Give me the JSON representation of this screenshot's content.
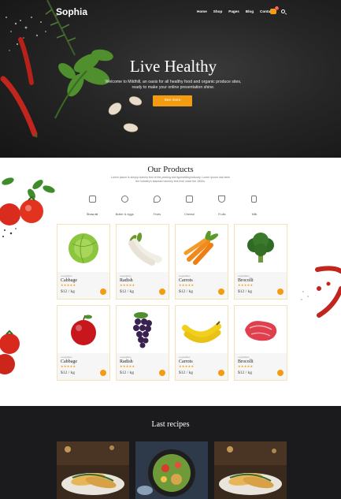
{
  "header": {
    "logo": "Sophia",
    "nav": [
      "Home",
      "Shop",
      "Pages",
      "Blog",
      "Contact"
    ],
    "cart_count": "0"
  },
  "hero": {
    "title": "Live Healthy",
    "subtitle": "Welcome to Mildhill, an oasis for all healthy food and organic produce sites, ready to make your online presentation shine.",
    "button": "See more"
  },
  "products": {
    "title": "Our Products",
    "description": "Lorem Ipsum is simply dummy text of the printing and typesetting industry. Lorem Ipsum has been the industry's standard dummy text ever since the 1500s.",
    "filters": [
      {
        "label": "Show all",
        "icon": "basket-icon"
      },
      {
        "label": "Butter & eggs",
        "icon": "egg-icon"
      },
      {
        "label": "Fruits",
        "icon": "fruit-icon"
      },
      {
        "label": "Cheese",
        "icon": "cheese-icon"
      },
      {
        "label": "Fruits",
        "icon": "bowl-icon"
      },
      {
        "label": "Milk",
        "icon": "milk-icon"
      }
    ],
    "items": [
      {
        "category": "vegetables",
        "name": "Cabbage",
        "rating": "★★★★★",
        "price": "$12 / kg",
        "visual": "cabbage"
      },
      {
        "category": "vegetables",
        "name": "Radish",
        "rating": "★★★★★",
        "price": "$12 / kg",
        "visual": "radish"
      },
      {
        "category": "vegetables",
        "name": "Carrots",
        "rating": "★★★★★",
        "price": "$12 / kg",
        "visual": "carrots"
      },
      {
        "category": "vegetables",
        "name": "Brocolli",
        "rating": "★★★★★",
        "price": "$12 / kg",
        "visual": "broccoli"
      },
      {
        "category": "vegetables",
        "name": "Cabbage",
        "rating": "★★★★★",
        "price": "$12 / kg",
        "visual": "apple"
      },
      {
        "category": "vegetables",
        "name": "Radish",
        "rating": "★★★★★",
        "price": "$12 / kg",
        "visual": "grapes"
      },
      {
        "category": "vegetables",
        "name": "Carrots",
        "rating": "★★★★★",
        "price": "$12 / kg",
        "visual": "bananas"
      },
      {
        "category": "vegetables",
        "name": "Brocolli",
        "rating": "★★★★★",
        "price": "$12 / kg",
        "visual": "meat"
      }
    ]
  },
  "recipes": {
    "title": "Last recipes"
  },
  "colors": {
    "accent": "#f39c12",
    "dark": "#1b1b1d",
    "hero_bg": "#262626"
  }
}
